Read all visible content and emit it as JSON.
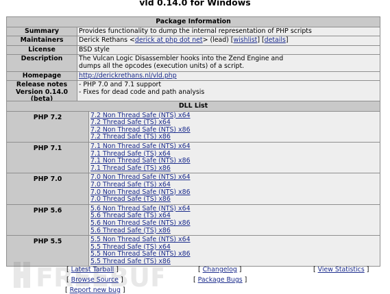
{
  "page": {
    "title": "vld 0.14.0 for Windows"
  },
  "package": {
    "header": "Package Information",
    "summary_label": "Summary",
    "summary": "Provides functionality to dump the internal representation of PHP scripts",
    "maintainers_label": "Maintainers",
    "maintainer_name": "Derick Rethans <",
    "maintainer_email": "derick at php dot net",
    "maintainer_role": "> (lead) [",
    "wishlist": "wishlist",
    "sep": "] [",
    "details": "details",
    "end": "]",
    "license_label": "License",
    "license": "BSD style",
    "description_label": "Description",
    "description_lines": [
      "The Vulcan Logic Disassembler hooks into the Zend Engine and",
      "dumps all the opcodes (execution units) of a script."
    ],
    "homepage_label": "Homepage",
    "homepage": "http://derickrethans.nl/vld.php",
    "release_label_lines": [
      "Release notes",
      "Version 0.14.0",
      "(beta)"
    ],
    "release_notes": [
      "- PHP 7.0 and 7.1 support",
      "- Fixes for dead code and path analysis"
    ]
  },
  "dll": {
    "header": "DLL List",
    "groups": [
      {
        "label": "PHP 7.2",
        "links": [
          "7.2 Non Thread Safe (NTS) x64",
          "7.2 Thread Safe (TS) x64",
          "7.2 Non Thread Safe (NTS) x86",
          "7.2 Thread Safe (TS) x86"
        ]
      },
      {
        "label": "PHP 7.1",
        "links": [
          "7.1 Non Thread Safe (NTS) x64",
          "7.1 Thread Safe (TS) x64",
          "7.1 Non Thread Safe (NTS) x86",
          "7.1 Thread Safe (TS) x86"
        ]
      },
      {
        "label": "PHP 7.0",
        "links": [
          "7.0 Non Thread Safe (NTS) x64",
          "7.0 Thread Safe (TS) x64",
          "7.0 Non Thread Safe (NTS) x86",
          "7.0 Thread Safe (TS) x86"
        ]
      },
      {
        "label": "PHP 5.6",
        "links": [
          "5.6 Non Thread Safe (NTS) x64",
          "5.6 Thread Safe (TS) x64",
          "5.6 Non Thread Safe (NTS) x86",
          "5.6 Thread Safe (TS) x86"
        ]
      },
      {
        "label": "PHP 5.5",
        "links": [
          "5.5 Non Thread Safe (NTS) x64",
          "5.5 Thread Safe (TS) x64",
          "5.5 Non Thread Safe (NTS) x86",
          "5.5 Thread Safe (TS) x86"
        ]
      }
    ]
  },
  "footer": {
    "open": "[ ",
    "close": " ]",
    "latest_tarball": "Latest Tarball",
    "changelog": "Changelog",
    "view_statistics": "View Statistics",
    "browse_source": "Browse Source",
    "package_bugs": "Package Bugs",
    "report_new_bug": "Report new bug"
  },
  "watermark": {
    "text": "FREEBUF"
  }
}
